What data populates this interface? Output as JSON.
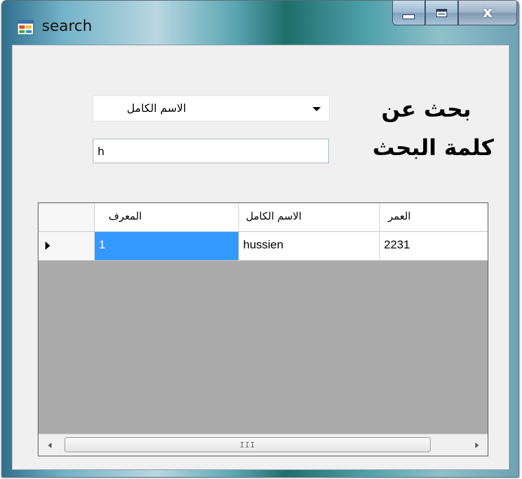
{
  "window": {
    "title": "search",
    "icon": "form-window-icon",
    "caption_buttons": {
      "minimize_icon": "minimize-icon",
      "maximize_icon": "maximize-icon",
      "close_glyph": "x"
    }
  },
  "form": {
    "search_by_label": "بحث عن",
    "search_by_selected": "الاسم الكامل",
    "keyword_label": "كلمة البحث",
    "keyword_value": "h"
  },
  "grid": {
    "columns": [
      "المعرف",
      "الاسم الكامل",
      "العمر"
    ],
    "rows": [
      {
        "id": "1",
        "full_name": "hussien",
        "age": "2231"
      }
    ],
    "selection_color": "#3399ff",
    "empty_area_color": "#ababab",
    "scroll_grip": "III"
  }
}
